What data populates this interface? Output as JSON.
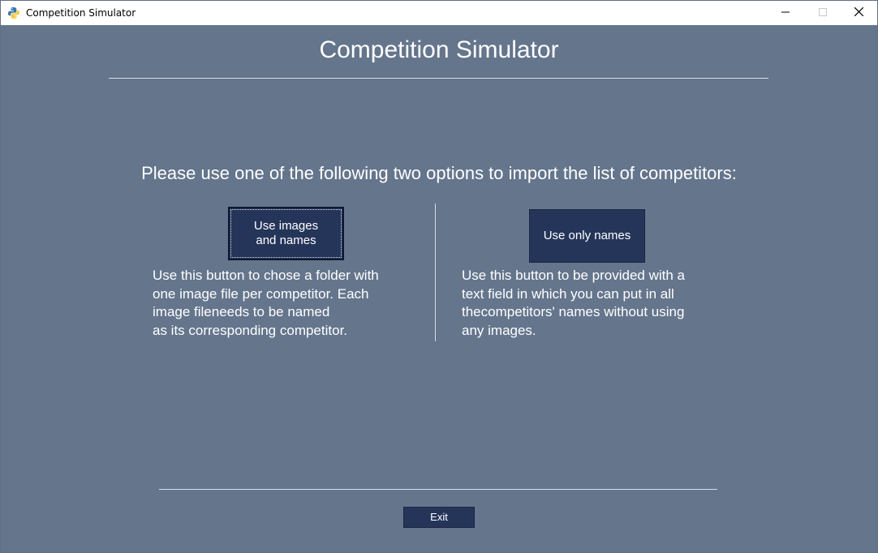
{
  "window": {
    "title": "Competition Simulator",
    "app_icon": "python-icon",
    "controls": [
      "minimize-icon",
      "maximize-icon",
      "close-icon"
    ]
  },
  "main": {
    "title": "Competition Simulator",
    "instruction": "Please use one of the following two options to import the list of competitors:",
    "options": [
      {
        "button_label": "Use images\nand names",
        "description": "Use this button to chose a folder with\none image file per competitor. Each\nimage fileneeds to be named\nas its corresponding competitor."
      },
      {
        "button_label": "Use only names",
        "description": "Use this button to be provided with a\ntext field in which you can put in all\nthecompetitors' names without using\nany images."
      }
    ],
    "exit_label": "Exit"
  },
  "colors": {
    "background": "#64758c",
    "button": "#25355a",
    "text": "#ffffff",
    "divider": "#d9dee6"
  }
}
